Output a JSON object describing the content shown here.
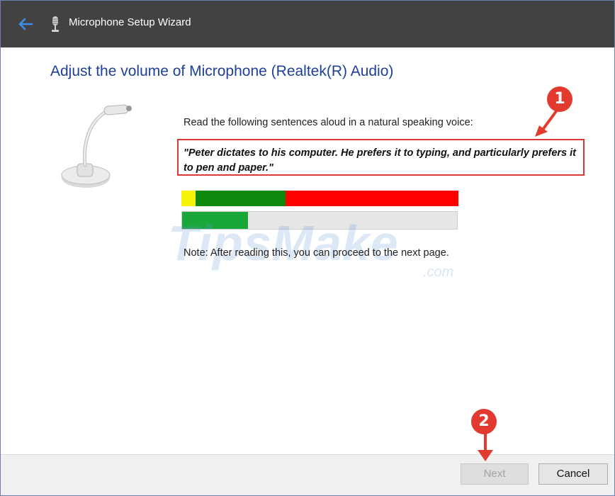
{
  "window": {
    "title": "Microphone Setup Wizard",
    "back_icon": "back-arrow-icon",
    "app_icon": "microphone-icon"
  },
  "main": {
    "heading": "Adjust the volume of Microphone (Realtek(R) Audio)",
    "instruction": "Read the following sentences aloud in a natural speaking voice:",
    "sentence": "\"Peter dictates to his computer. He prefers it to typing, and particularly prefers it to pen and paper.\"",
    "note": "Note: After reading this, you can proceed to the next page.",
    "input_level_fraction": 0.24
  },
  "buttons": {
    "next_label": "Next",
    "next_enabled": false,
    "cancel_label": "Cancel"
  },
  "annotations": {
    "marker1": "1",
    "marker2": "2",
    "marker_color": "#e23a2e"
  },
  "watermark": {
    "text": "TipsMake",
    "suffix": ".com"
  },
  "colors": {
    "title_bar": "#424242",
    "heading": "#1e3f9a",
    "meter_red": "#ff0000",
    "meter_green": "#0d8a0d",
    "meter_yellow": "#f7f40a",
    "level_green": "#1aa73a"
  }
}
